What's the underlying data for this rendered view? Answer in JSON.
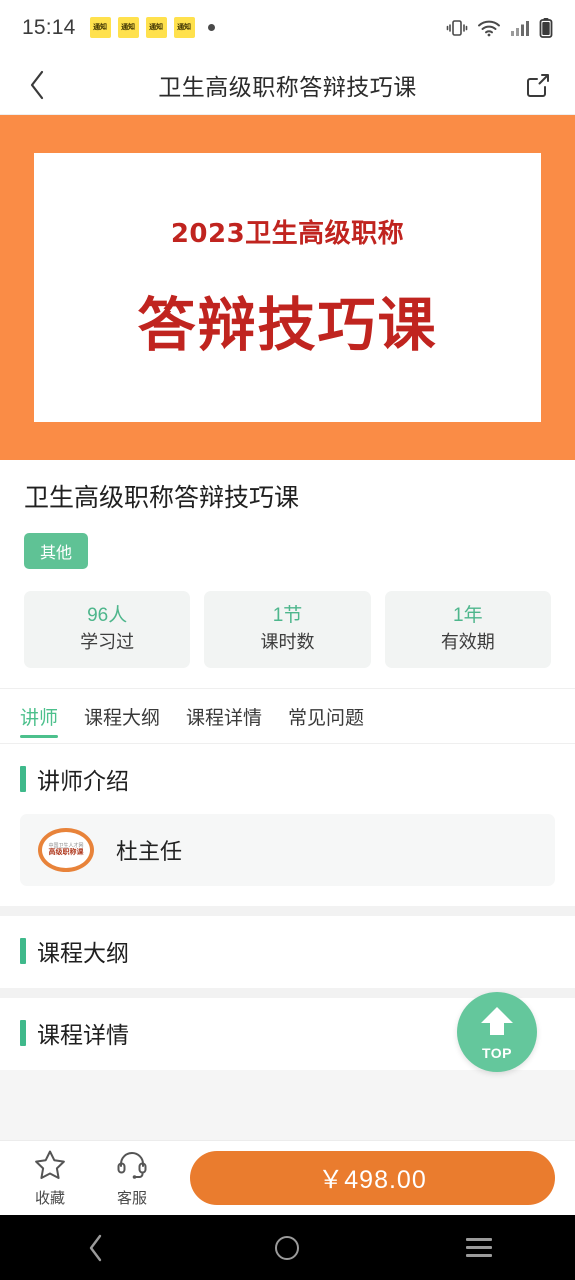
{
  "status_bar": {
    "time": "15:14",
    "badges": [
      "通知",
      "通知",
      "通知",
      "通知"
    ],
    "icons": [
      "vibrate-icon",
      "wifi-icon",
      "signal-icon",
      "battery-icon"
    ]
  },
  "header": {
    "back_icon": "chevron-left-icon",
    "title": "卫生高级职称答辩技巧课",
    "share_icon": "share-icon"
  },
  "banner": {
    "background_color": "#fa8c46",
    "subtitle": "2023卫生高级职称",
    "title": "答辩技巧课",
    "text_color": "#c0241f"
  },
  "course": {
    "title": "卫生高级职称答辩技巧课",
    "tag": "其他",
    "tag_color": "#5fc295",
    "stats": [
      {
        "value": "96人",
        "label": "学习过"
      },
      {
        "value": "1节",
        "label": "课时数"
      },
      {
        "value": "1年",
        "label": "有效期"
      }
    ]
  },
  "tabs": {
    "active_color": "#4cc08c",
    "items": [
      {
        "label": "讲师",
        "active": true
      },
      {
        "label": "课程大纲",
        "active": false
      },
      {
        "label": "课程详情",
        "active": false
      },
      {
        "label": "常见问题",
        "active": false
      }
    ]
  },
  "sections": {
    "instructor": {
      "title": "讲师介绍",
      "teacher": {
        "name": "杜主任",
        "avatar_line1": "中国卫生人才网",
        "avatar_line2": "高级职称课"
      }
    },
    "outline": {
      "title": "课程大纲"
    },
    "detail": {
      "title": "课程详情"
    }
  },
  "top_button": {
    "label": "TOP",
    "icon": "arrow-up-icon",
    "color": "#64c79c"
  },
  "bottom_bar": {
    "actions": [
      {
        "icon": "star-icon",
        "label": "收藏"
      },
      {
        "icon": "headset-icon",
        "label": "客服"
      }
    ],
    "buy_button": {
      "price": "￥498.00",
      "color": "#ea7c2e"
    }
  },
  "android_nav": {
    "back_icon": "chevron-left-icon",
    "home_icon": "circle-icon",
    "recents_icon": "menu-icon"
  }
}
